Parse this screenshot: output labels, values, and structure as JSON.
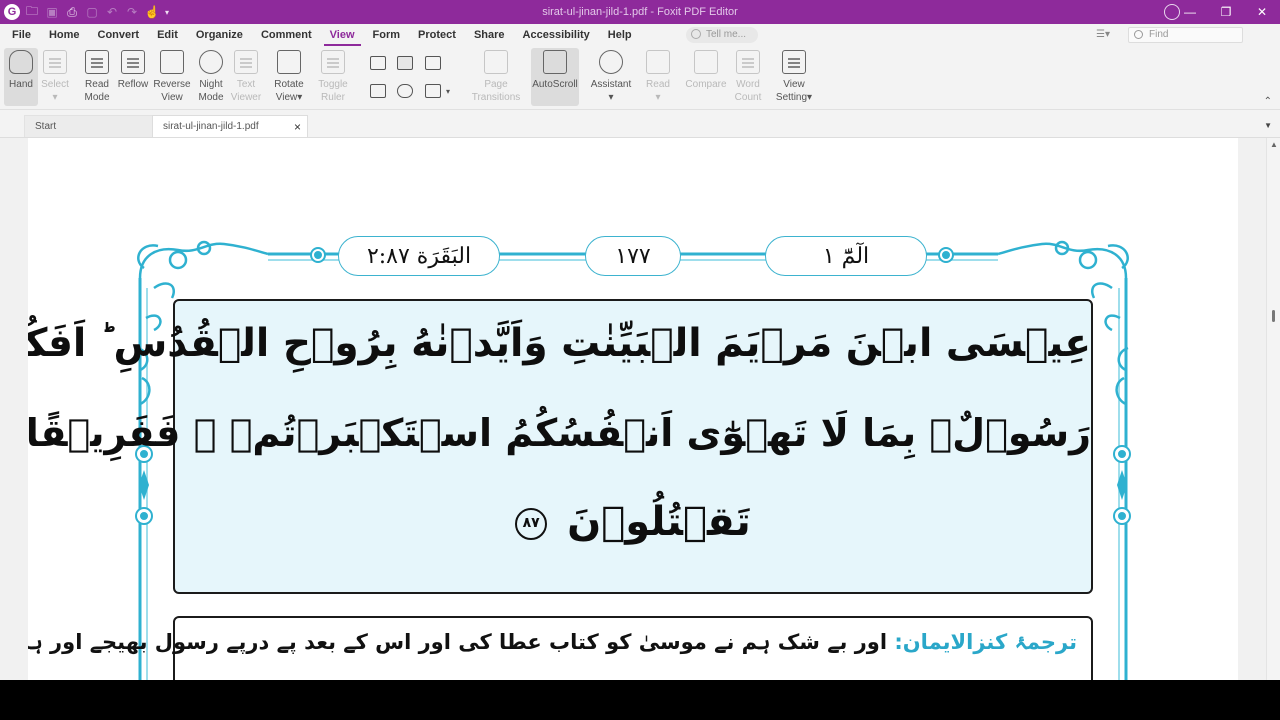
{
  "window": {
    "title": "sirat-ul-jinan-jild-1.pdf - Foxit PDF Editor",
    "logo_letter": "G"
  },
  "menu": {
    "items": [
      "File",
      "Home",
      "Convert",
      "Edit",
      "Organize",
      "Comment",
      "View",
      "Form",
      "Protect",
      "Share",
      "Accessibility",
      "Help"
    ],
    "active": "View",
    "tell_me_placeholder": "Tell me...",
    "find_placeholder": "Find"
  },
  "ribbon": {
    "hand": [
      "Hand",
      ""
    ],
    "select": [
      "Select",
      "▾"
    ],
    "read_mode": [
      "Read",
      "Mode"
    ],
    "reflow": [
      "Reflow",
      ""
    ],
    "reverse_view": [
      "Reverse",
      "View"
    ],
    "night_mode": [
      "Night",
      "Mode"
    ],
    "text_viewer": [
      "Text",
      "Viewer"
    ],
    "rotate_view": [
      "Rotate",
      "View▾"
    ],
    "toggle_ruler": [
      "Toggle",
      "Ruler"
    ],
    "page_transitions": [
      "Page",
      "Transitions"
    ],
    "autoscroll": [
      "AutoScroll",
      ""
    ],
    "assistant": [
      "Assistant",
      "▾"
    ],
    "read": [
      "Read",
      "▾"
    ],
    "compare": [
      "Compare",
      ""
    ],
    "word_count": [
      "Word",
      "Count"
    ],
    "view_setting": [
      "View",
      "Setting▾"
    ]
  },
  "tabs": {
    "start": "Start",
    "document": "sirat-ul-jinan-jild-1.pdf",
    "close": "×"
  },
  "page": {
    "header_right": "الٓمّٓ ١",
    "header_center": "١٧٧",
    "header_left": "البَقَرَة ٢:٨٧",
    "ayah_line1": "عِيۡسَى ابۡنَ مَرۡيَمَ الۡبَيِّنٰتِ وَاَيَّدۡنٰهُ بِرُوۡحِ الۡقُدُسِ ؕ اَفَكُلَّمَا جَآءَكُمۡ",
    "ayah_line2": "رَسُوۡلٌۢ بِمَا لَا تَهۡوٰٓى اَنۡفُسُكُمُ اسۡتَكۡبَرۡتُمۡ ۚ فَفَرِيۡقًا كَذَّبۡتُمۡ ۫ وَفَرِيۡقًا",
    "ayah_line3": "تَقۡتُلُوۡنَ",
    "ayah_number": "٨٧",
    "translation_label": "ترجمۂ کنزالایمان:",
    "translation_text": " اور بے شک ہم نے موسیٰ کو کتاب عطا کی اور اس کے بعد پے درپے رسول بھیجے اور ہم نے عیسیٰ"
  }
}
